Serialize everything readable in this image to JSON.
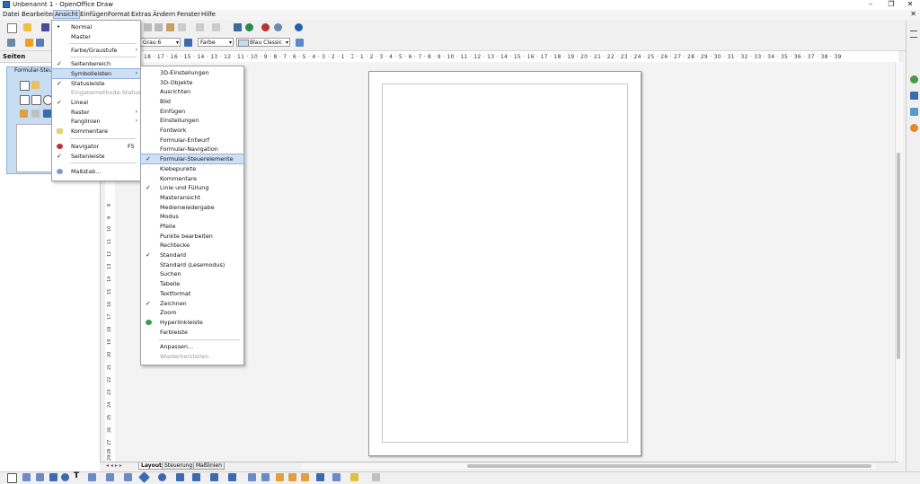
{
  "window": {
    "title": "Unbenannt 1 - OpenOffice Draw",
    "minimize": "–",
    "maximize": "❐",
    "close": "✕"
  },
  "menubar": {
    "items": [
      "Datei",
      "Bearbeiten",
      "Ansicht",
      "Einfügen",
      "Format",
      "Extras",
      "Ändern",
      "Fenster",
      "Hilfe"
    ],
    "close_doc": "✕"
  },
  "toolbar2": {
    "line_color": "Grau 6",
    "fill_type": "Farbe",
    "fill_color": "Blau Classic"
  },
  "pages_panel": {
    "title": "Seiten",
    "close": "✕",
    "floating_toolbar_title": "Formular-Steu"
  },
  "ruler": {
    "horizontal": "18 · 17 · 16 · 15 · 14 · 13 · 12 · 11 · 10 · 9 · 8 · 7 · 6 · 5 · 4 · 3 · 2 · 1 · ⌶ · 1 · 2 · 3 · 4 · 5 · 6 · 7 · 8 · 9 · 10 · 11 · 12 · 13 · 14 · 15 · 16 · 17 · 18 · 19 · 20 · 21 · 22 · 23 · 24 · 25 · 26 · 27 · 28 · 29 · 30 · 31 · 32 · 33 · 34 · 35 · 36 · 37 · 38 · 39",
    "vertical": [
      "8",
      "9",
      "10",
      "11",
      "12",
      "13",
      "14",
      "15",
      "16",
      "17",
      "18",
      "19",
      "20",
      "21",
      "22",
      "23",
      "24",
      "25",
      "26",
      "27",
      "28",
      "29"
    ]
  },
  "tabs": [
    "Layout",
    "Steuerung",
    "Maßlinien"
  ],
  "ansicht_menu": {
    "items": [
      {
        "label": "Normal",
        "check": "•"
      },
      {
        "label": "Master",
        "check": ""
      },
      {
        "label": "Farbe/Graustufe",
        "check": "",
        "submenu": "›"
      },
      {
        "label": "Seitenbereich",
        "check": "✓"
      },
      {
        "label": "Symbolleisten",
        "check": "",
        "submenu": "›"
      },
      {
        "label": "Statusleiste",
        "check": "✓"
      },
      {
        "label": "Eingabemethode-Status",
        "check": ""
      },
      {
        "label": "Lineal",
        "check": "✓"
      },
      {
        "label": "Raster",
        "check": "",
        "submenu": "›"
      },
      {
        "label": "Fanglinien",
        "check": "",
        "submenu": "›"
      },
      {
        "label": "Kommentare",
        "check": ""
      },
      {
        "label": "Navigator",
        "check": "",
        "shortcut": "F5"
      },
      {
        "label": "Seitenleiste",
        "check": "✓"
      },
      {
        "label": "Maßstab...",
        "check": ""
      }
    ]
  },
  "symbolleisten_menu": {
    "items": [
      {
        "label": "3D-Einstellungen",
        "check": ""
      },
      {
        "label": "3D-Objekte",
        "check": ""
      },
      {
        "label": "Ausrichten",
        "check": ""
      },
      {
        "label": "Bild",
        "check": ""
      },
      {
        "label": "Einfügen",
        "check": ""
      },
      {
        "label": "Einstellungen",
        "check": ""
      },
      {
        "label": "Fontwork",
        "check": ""
      },
      {
        "label": "Formular-Entwurf",
        "check": ""
      },
      {
        "label": "Formular-Navigation",
        "check": ""
      },
      {
        "label": "Formular-Steuerelemente",
        "check": "✓"
      },
      {
        "label": "Klebepunkte",
        "check": ""
      },
      {
        "label": "Kommentare",
        "check": ""
      },
      {
        "label": "Linie und Füllung",
        "check": "✓"
      },
      {
        "label": "Masteransicht",
        "check": ""
      },
      {
        "label": "Medienwiedergabe",
        "check": ""
      },
      {
        "label": "Modus",
        "check": ""
      },
      {
        "label": "Pfeile",
        "check": ""
      },
      {
        "label": "Punkte bearbeiten",
        "check": ""
      },
      {
        "label": "Rechtecke",
        "check": ""
      },
      {
        "label": "Standard",
        "check": "✓"
      },
      {
        "label": "Standard (Lesemodus)",
        "check": ""
      },
      {
        "label": "Suchen",
        "check": ""
      },
      {
        "label": "Tabelle",
        "check": ""
      },
      {
        "label": "Textformat",
        "check": ""
      },
      {
        "label": "Zeichnen",
        "check": "✓"
      },
      {
        "label": "Zoom",
        "check": ""
      },
      {
        "label": "Hyperlinkleiste",
        "check": ""
      },
      {
        "label": "Farbleiste",
        "check": ""
      },
      {
        "label": "Anpassen...",
        "check": ""
      },
      {
        "label": "Wiederherstellen",
        "check": ""
      }
    ]
  }
}
